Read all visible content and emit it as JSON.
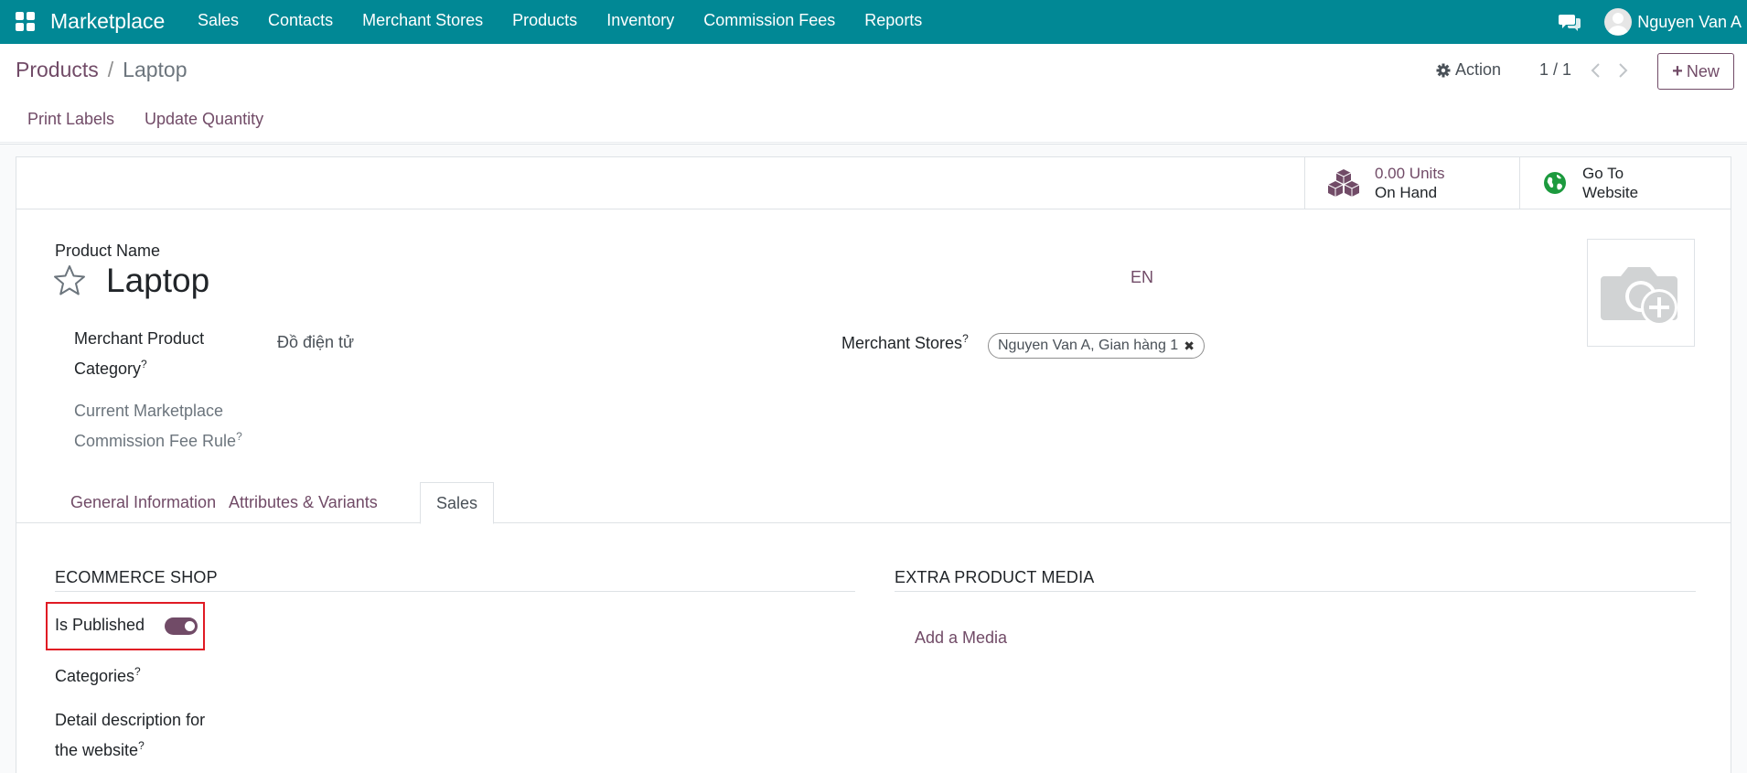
{
  "navbar": {
    "brand": "Marketplace",
    "menu": [
      "Sales",
      "Contacts",
      "Merchant Stores",
      "Products",
      "Inventory",
      "Commission Fees",
      "Reports"
    ],
    "user_name": "Nguyen Van A"
  },
  "control": {
    "breadcrumb_parent": "Products",
    "breadcrumb_separator": "/",
    "breadcrumb_current": "Laptop",
    "action_label": "Action",
    "pager_value": "1 / 1",
    "new_label": "New",
    "statusbar": {
      "print_labels": "Print Labels",
      "update_quantity": "Update Quantity"
    }
  },
  "stat_buttons": {
    "units_value": "0.00 Units",
    "units_label": "On Hand",
    "website_line1": "Go To",
    "website_line2": "Website"
  },
  "form": {
    "product_name_label": "Product Name",
    "product_name": "Laptop",
    "lang": "EN",
    "merchant_category_label_1": "Merchant Product",
    "merchant_category_label_2": "Category",
    "merchant_category_value": "Đồ điện tử",
    "commission_label_1": "Current Marketplace",
    "commission_label_2": "Commission Fee Rule",
    "merchant_stores_label": "Merchant Stores",
    "merchant_store_tag": "Nguyen Van A, Gian hàng 1",
    "tooltip_mark": "?"
  },
  "tabs": [
    {
      "label": "General Information",
      "active": false
    },
    {
      "label": "Attributes & Variants",
      "active": false
    },
    {
      "label": "Sales",
      "active": true
    }
  ],
  "sales_tab": {
    "ecommerce_title": "ECOMMERCE SHOP",
    "is_published_label": "Is Published",
    "is_published": true,
    "categories_label": "Categories",
    "detail_desc_label_1": "Detail description for",
    "detail_desc_label_2": "the website",
    "extra_media_title": "EXTRA PRODUCT MEDIA",
    "add_media_label": "Add a Media"
  },
  "colors": {
    "navbar": "#018895",
    "primary": "#714b67",
    "highlight": "#e01b24"
  },
  "icons": [
    "apps-icon",
    "chat-icon",
    "avatar",
    "gear-icon",
    "chevron-left-icon",
    "chevron-right-icon",
    "plus-icon",
    "cubes-icon",
    "globe-icon",
    "star-icon",
    "camera-plus-icon",
    "close-icon"
  ]
}
